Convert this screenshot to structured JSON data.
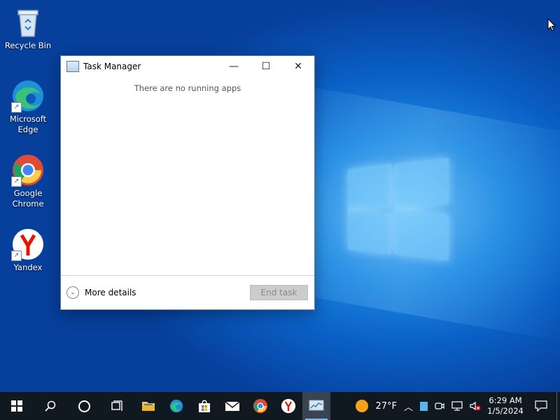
{
  "desktop": {
    "icons": [
      {
        "label": "Recycle Bin"
      },
      {
        "label_line1": "Microsoft",
        "label_line2": "Edge"
      },
      {
        "label_line1": "Google",
        "label_line2": "Chrome"
      },
      {
        "label": "Yandex"
      }
    ]
  },
  "task_manager": {
    "title": "Task Manager",
    "minimize": "—",
    "maximize": "☐",
    "close": "✕",
    "empty_message": "There are no running apps",
    "more_details": "More details",
    "end_task": "End task"
  },
  "taskbar": {
    "weather_temp": "27°F",
    "time": "6:29 AM",
    "date": "1/5/2024"
  },
  "colors": {
    "desktop_blue": "#0a5fc4",
    "taskbar": "#101820",
    "end_task_disabled": "#cccccc"
  }
}
